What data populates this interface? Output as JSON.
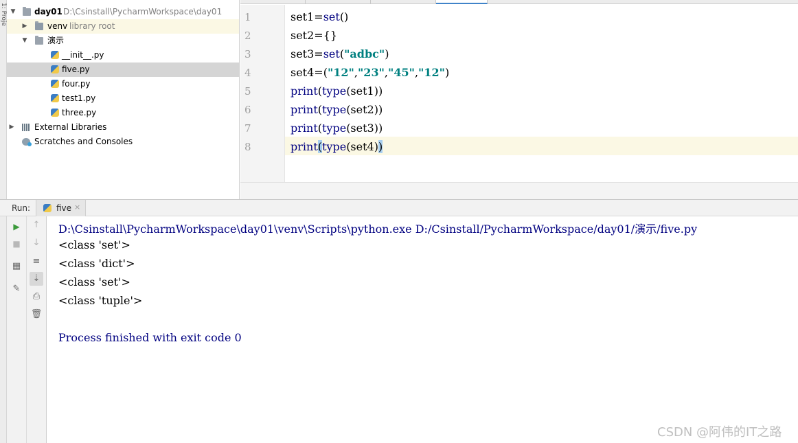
{
  "side_strip": {
    "label": "1: Proje"
  },
  "project_tree": {
    "root": {
      "name": "day01",
      "path": "D:\\Csinstall\\PycharmWorkspace\\day01"
    },
    "venv": {
      "name": "venv",
      "hint": "library root"
    },
    "folder": {
      "name": "演示"
    },
    "files": [
      {
        "name": "__init__.py"
      },
      {
        "name": "five.py"
      },
      {
        "name": "four.py"
      },
      {
        "name": "test1.py"
      },
      {
        "name": "three.py"
      }
    ],
    "external_libraries": "External Libraries",
    "scratches": "Scratches and Consoles"
  },
  "editor": {
    "line_numbers": [
      "1",
      "2",
      "3",
      "4",
      "5",
      "6",
      "7",
      "8"
    ],
    "lines": [
      {
        "a": "set1=",
        "fn": "set",
        "b": "()"
      },
      {
        "a": "set2={}"
      },
      {
        "a": "set3=",
        "fn": "set",
        "b": "(",
        "s": "\"adbc\"",
        "c": ")"
      },
      {
        "a": "set4=(",
        "s1": "\"12\"",
        "c1": ",",
        "s2": "\"23\"",
        "c2": ",",
        "s3": "\"45\"",
        "c3": ",",
        "s4": "\"12\"",
        "c4": ")"
      },
      {
        "fn": "print",
        "b": "(",
        "fn2": "type",
        "c": "(set1))"
      },
      {
        "fn": "print",
        "b": "(",
        "fn2": "type",
        "c": "(set2))"
      },
      {
        "fn": "print",
        "b": "(",
        "fn2": "type",
        "c": "(set3))"
      },
      {
        "fn": "print",
        "b": "(",
        "fn2": "type",
        "c": "(set4)",
        "d": ")"
      }
    ]
  },
  "run": {
    "label": "Run:",
    "tab_name": "five",
    "tab_close": "×",
    "console": [
      "D:\\Csinstall\\PycharmWorkspace\\day01\\venv\\Scripts\\python.exe D:/Csinstall/PycharmWorkspace/day01/演示/five.py",
      "<class 'set'>",
      "<class 'dict'>",
      "<class 'set'>",
      "<class 'tuple'>",
      "",
      "Process finished with exit code 0"
    ]
  },
  "watermark": "CSDN @阿伟的IT之路"
}
